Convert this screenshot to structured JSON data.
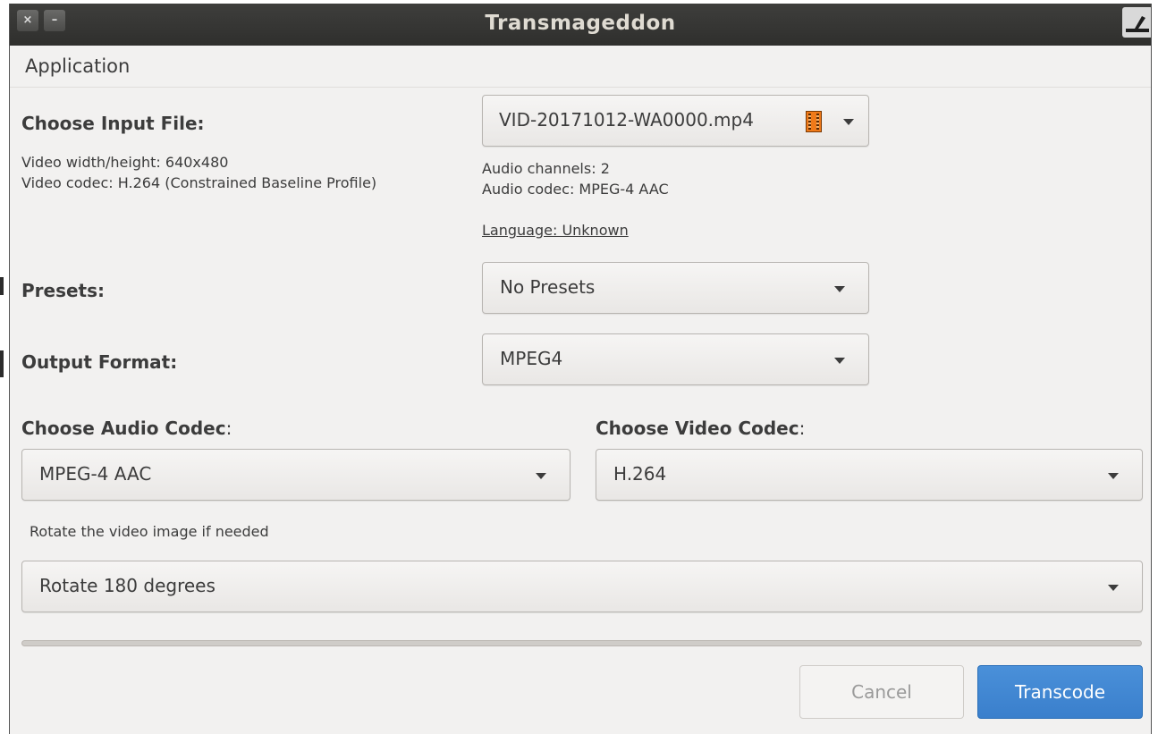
{
  "window": {
    "title": "Transmageddon"
  },
  "menubar": {
    "application": "Application"
  },
  "input": {
    "label": "Choose Input File:",
    "file": "VID-20171012-WA0000.mp4",
    "video_size": "Video width/height: 640x480",
    "video_codec": "Video codec: H.264 (Constrained Baseline Profile)",
    "audio_channels": "Audio channels: 2",
    "audio_codec": "Audio codec: MPEG-4 AAC",
    "language": "Language: Unknown"
  },
  "presets": {
    "label": "Presets:",
    "value": "No Presets"
  },
  "output_format": {
    "label": "Output Format:",
    "value": "MPEG4"
  },
  "audio_codec": {
    "label_bold": "Choose Audio Codec",
    "label_colon": ":",
    "value": "MPEG-4 AAC"
  },
  "video_codec": {
    "label_bold": "Choose Video Codec",
    "label_colon": ":",
    "value": "H.264"
  },
  "rotate": {
    "label": "Rotate the video image if needed",
    "value": "Rotate 180 degrees"
  },
  "buttons": {
    "cancel": "Cancel",
    "transcode": "Transcode"
  }
}
